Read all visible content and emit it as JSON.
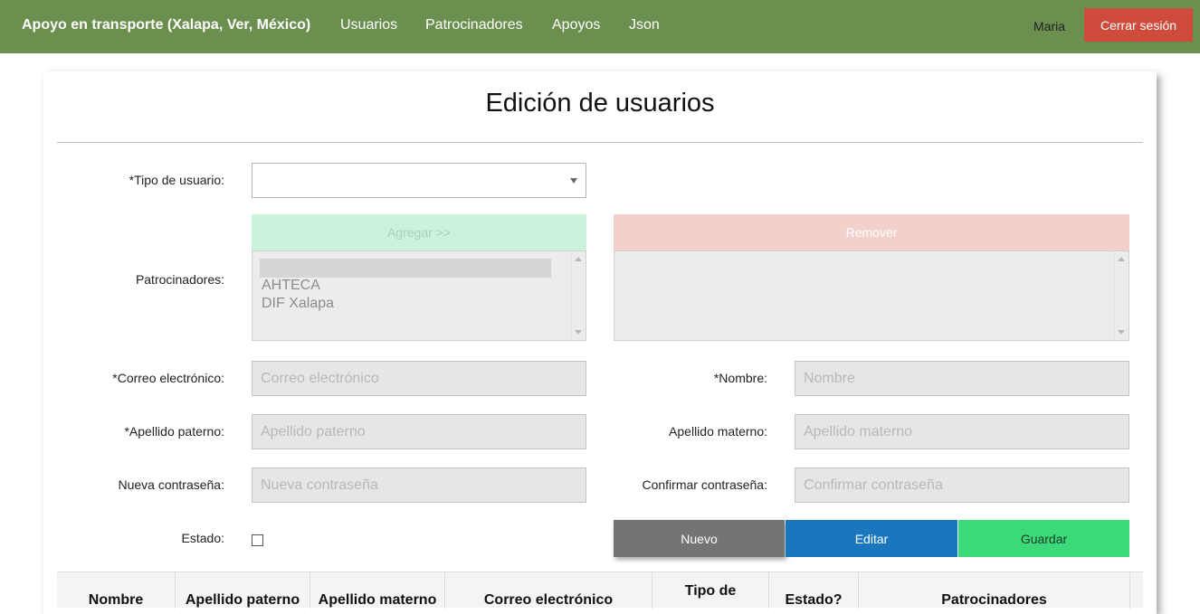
{
  "navbar": {
    "brand": "Apoyo en transporte (Xalapa, Ver, México)",
    "links": [
      "Usuarios",
      "Patrocinadores",
      "Apoyos",
      "Json"
    ],
    "user": "Maria",
    "logout": "Cerrar sesión"
  },
  "form": {
    "title": "Edición de usuarios",
    "tipo_label": "*Tipo de usuario:",
    "tipo_value": "",
    "patrocinadores_label": "Patrocinadores:",
    "add_button": "Agregar >>",
    "remove_button": "Remover",
    "available": [
      "AHTECA",
      "DIF Xalapa"
    ],
    "correo_label": "*Correo electrónico:",
    "correo_placeholder": "Correo electrónico",
    "nombre_label": "*Nombre:",
    "nombre_placeholder": "Nombre",
    "paterno_label": "*Apellido paterno:",
    "paterno_placeholder": "Apellido paterno",
    "materno_label": "Apellido materno:",
    "materno_placeholder": "Apellido materno",
    "pass_label": "Nueva contraseña:",
    "pass_placeholder": "Nueva contraseña",
    "confirm_label": "Confirmar contraseña:",
    "confirm_placeholder": "Confirmar contraseña",
    "estado_label": "Estado:",
    "actions": {
      "nuevo": "Nuevo",
      "editar": "Editar",
      "guardar": "Guardar"
    }
  },
  "table": {
    "headers": [
      "Nombre",
      "Apellido paterno",
      "Apellido materno",
      "Correo electrónico",
      "Tipo de",
      "Estado?",
      "Patrocinadores"
    ]
  },
  "colors": {
    "navbar": "#6a8f4e",
    "logout": "#cf4b3c",
    "nuevo": "#747474",
    "editar": "#1a77bd",
    "guardar": "#3bd978"
  }
}
